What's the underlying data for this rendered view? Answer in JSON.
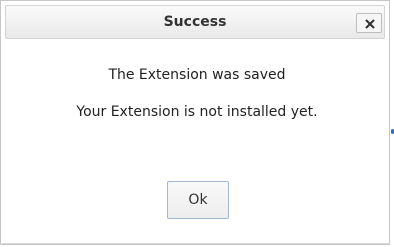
{
  "dialog": {
    "title": "Success",
    "close_icon": "close-x-icon",
    "message_line1": "The Extension was saved",
    "message_line2": "Your Extension is not installed yet.",
    "ok_label": "Ok"
  },
  "colors": {
    "title_text": "#333333",
    "button_border": "#a3b8d0",
    "accent_dot": "#2a72c8"
  }
}
